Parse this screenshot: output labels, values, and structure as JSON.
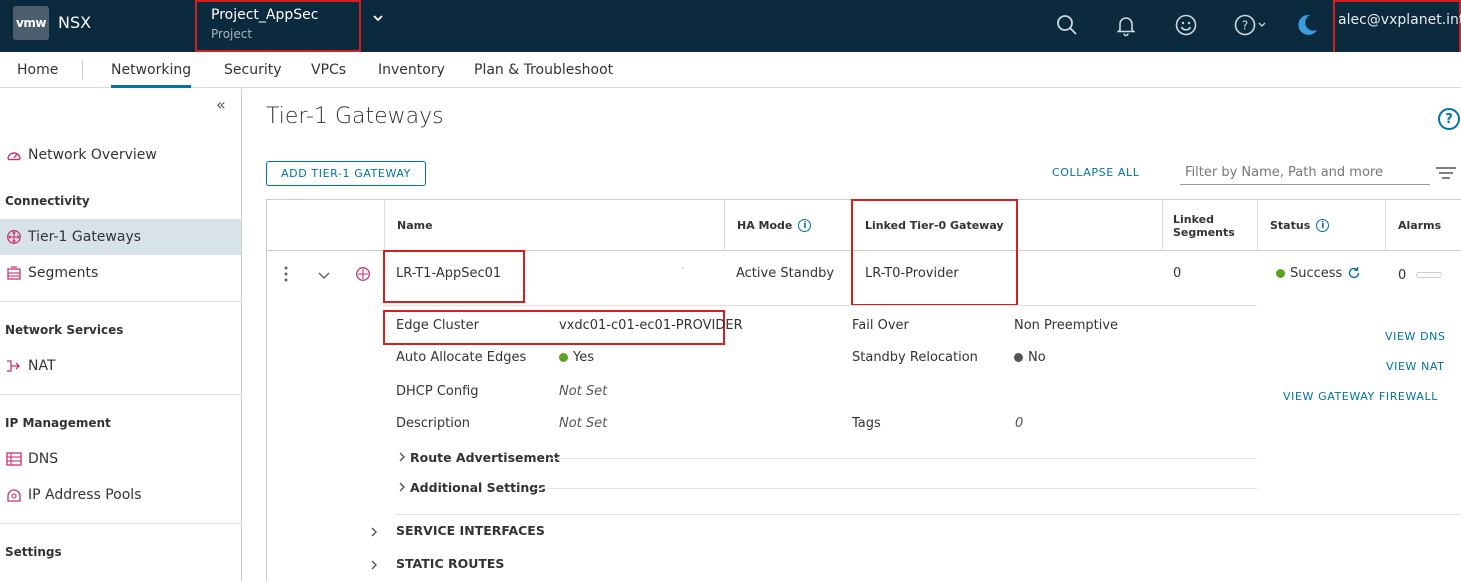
{
  "topbar": {
    "logo": "vmw",
    "app_name": "NSX",
    "project_name": "Project_AppSec",
    "project_label": "Project",
    "user": "alec@vxplanet.int",
    "icons": [
      "search-icon",
      "bell-icon",
      "smiley-icon",
      "help-icon",
      "moon-icon"
    ]
  },
  "nav": {
    "tabs": [
      "Home",
      "Networking",
      "Security",
      "VPCs",
      "Inventory",
      "Plan & Troubleshoot"
    ],
    "active": "Networking"
  },
  "sidebar": {
    "collapse_label": "«",
    "network_overview": "Network Overview",
    "connectivity_heading": "Connectivity",
    "tier1": "Tier-1 Gateways",
    "segments": "Segments",
    "network_services_heading": "Network Services",
    "nat": "NAT",
    "ip_management_heading": "IP Management",
    "dns": "DNS",
    "ip_pools": "IP Address Pools",
    "settings_heading": "Settings"
  },
  "main": {
    "title": "Tier-1 Gateways",
    "add_button": "ADD TIER-1 GATEWAY",
    "collapse_all": "COLLAPSE ALL",
    "filter_placeholder": "Filter by Name, Path and more",
    "columns": {
      "name": "Name",
      "ha_mode": "HA Mode",
      "linked_t0": "Linked Tier-0 Gateway",
      "linked_segments_1": "Linked",
      "linked_segments_2": "Segments",
      "status": "Status",
      "alarms": "Alarms"
    },
    "row": {
      "name": "LR-T1-AppSec01",
      "ha_mode": "Active Standby",
      "linked_t0": "LR-T0-Provider",
      "linked_segments": "0",
      "status": "Success",
      "alarms": "0"
    },
    "details": {
      "edge_cluster_label": "Edge Cluster",
      "edge_cluster_value": "vxdc01-c01-ec01-PROVIDER",
      "auto_allocate_label": "Auto Allocate Edges",
      "auto_allocate_value": "Yes",
      "dhcp_label": "DHCP Config",
      "dhcp_value": "Not Set",
      "description_label": "Description",
      "description_value": "Not Set",
      "failover_label": "Fail Over",
      "failover_value": "Non Preemptive",
      "standby_label": "Standby Relocation",
      "standby_value": "No",
      "tags_label": "Tags",
      "tags_value": "0",
      "route_adv": "Route Advertisement",
      "additional": "Additional Settings",
      "service_interfaces": "SERVICE INTERFACES",
      "static_routes": "STATIC ROUTES"
    },
    "actions": {
      "view_dns": "VIEW DNS",
      "view_nat": "VIEW NAT",
      "view_fw": "VIEW GATEWAY FIREWALL"
    }
  },
  "colors": {
    "topbar": "#0c2a3d",
    "accent": "#0072a3",
    "highlight": "#d21f1f",
    "success": "#5aa220"
  }
}
